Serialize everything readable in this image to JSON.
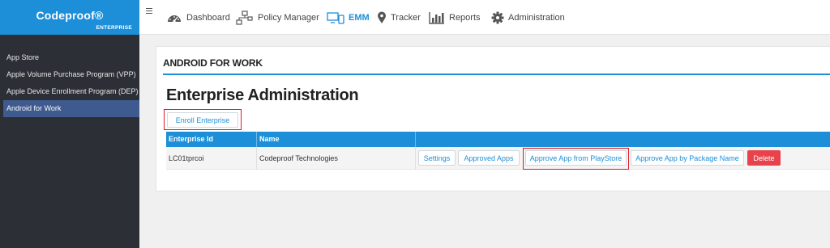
{
  "brand": {
    "name": "Codeproof®",
    "edition": "ENTERPRISE"
  },
  "sidebar": {
    "items": [
      {
        "label": "App Store"
      },
      {
        "label": "Apple Volume Purchase Program (VPP)"
      },
      {
        "label": "Apple Device Enrollment Program (DEP)"
      },
      {
        "label": "Android for Work",
        "active": true
      }
    ]
  },
  "topnav": {
    "items": [
      {
        "label": "Dashboard",
        "icon": "dashboard-icon"
      },
      {
        "label": "Policy Manager",
        "icon": "policy-icon"
      },
      {
        "label": "EMM",
        "icon": "devices-icon",
        "active": true
      },
      {
        "label": "Tracker",
        "icon": "map-pin-icon"
      },
      {
        "label": "Reports",
        "icon": "bar-chart-icon"
      },
      {
        "label": "Administration",
        "icon": "gear-icon"
      }
    ]
  },
  "main": {
    "section_title": "ANDROID FOR WORK",
    "page_title": "Enterprise Administration",
    "enroll_button": "Enroll Enterprise",
    "table": {
      "headers": [
        "Enterprise Id",
        "Name"
      ],
      "rows": [
        {
          "enterprise_id": "LC01tprcoi",
          "name": "Codeproof Technologies",
          "actions": {
            "settings": "Settings",
            "approved_apps": "Approved Apps",
            "approve_playstore": "Approve App from PlayStore",
            "approve_package": "Approve App by Package Name",
            "delete": "Delete"
          }
        }
      ]
    }
  },
  "colors": {
    "accent": "#1c8fd8",
    "sidebar_bg": "#2c2f36",
    "sidebar_active": "#3e5a8e",
    "highlight": "#e01b24",
    "danger": "#e8434c"
  }
}
